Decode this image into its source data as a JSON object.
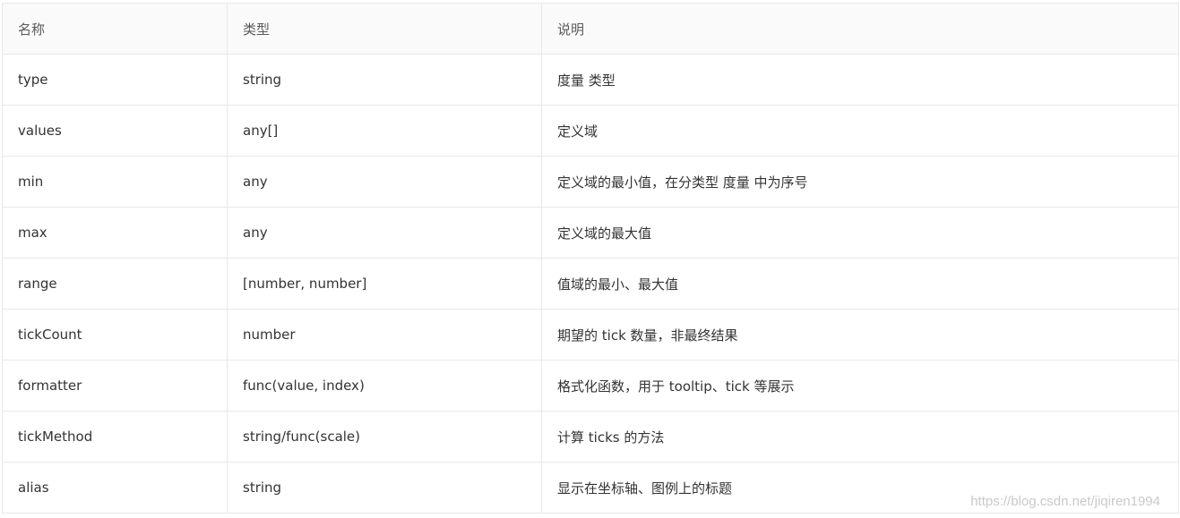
{
  "table": {
    "headers": [
      "名称",
      "类型",
      "说明"
    ],
    "rows": [
      [
        "type",
        "string",
        "度量 类型"
      ],
      [
        "values",
        "any[]",
        "定义域"
      ],
      [
        "min",
        "any",
        "定义域的最小值，在分类型 度量 中为序号"
      ],
      [
        "max",
        "any",
        "定义域的最大值"
      ],
      [
        "range",
        "[number, number]",
        "值域的最小、最大值"
      ],
      [
        "tickCount",
        "number",
        "期望的 tick 数量，非最终结果"
      ],
      [
        "formatter",
        "func(value, index)",
        "格式化函数，用于 tooltip、tick 等展示"
      ],
      [
        "tickMethod",
        "string/func(scale)",
        "计算 ticks 的方法"
      ],
      [
        "alias",
        "string",
        "显示在坐标轴、图例上的标题"
      ]
    ]
  },
  "watermark": "https://blog.csdn.net/jiqiren1994"
}
